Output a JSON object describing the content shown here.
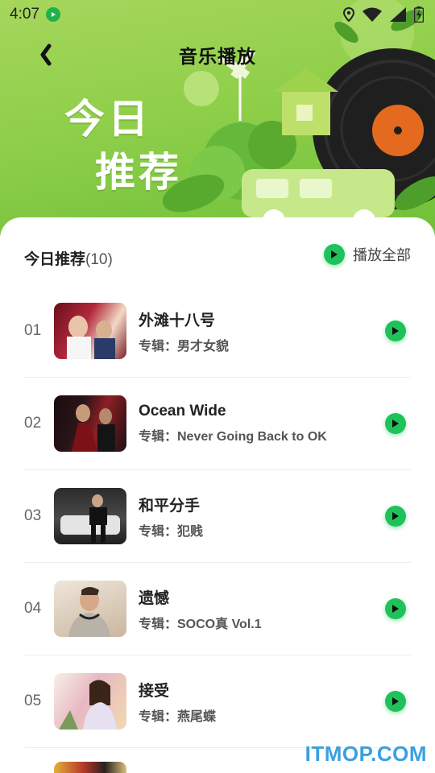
{
  "status_bar": {
    "time": "4:07",
    "icons": [
      "app-notification-icon",
      "location-icon",
      "wifi-icon",
      "signal-icon",
      "battery-icon"
    ]
  },
  "header": {
    "title": "音乐播放",
    "back_icon": "back-chevron-icon"
  },
  "hero": {
    "line1": "今日",
    "line2": "推荐"
  },
  "list": {
    "title": "今日推荐",
    "count": "(10)",
    "play_all_label": "播放全部",
    "songs": [
      {
        "index": "01",
        "name": "外滩十八号",
        "album": "专辑：男才女貌",
        "cover_colors": [
          "#b0283a",
          "#f3d9c4"
        ]
      },
      {
        "index": "02",
        "name": "Ocean Wide",
        "album": "专辑：Never Going Back to OK",
        "cover_colors": [
          "#2a1418",
          "#8e1f24"
        ]
      },
      {
        "index": "03",
        "name": "和平分手",
        "album": "专辑：犯贱",
        "cover_colors": [
          "#3a3a3a",
          "#d9d9d9"
        ]
      },
      {
        "index": "04",
        "name": "遗憾",
        "album": "专辑：SOCO真 Vol.1",
        "cover_colors": [
          "#c9b6a2",
          "#efe6dc"
        ]
      },
      {
        "index": "05",
        "name": "接受",
        "album": "专辑：燕尾蝶",
        "cover_colors": [
          "#e7b8c2",
          "#f7f0e6"
        ]
      }
    ]
  },
  "colors": {
    "accent_green": "#1fc25a",
    "hero_green": "#8fcf4a"
  },
  "watermark": "ITMOP.COM"
}
